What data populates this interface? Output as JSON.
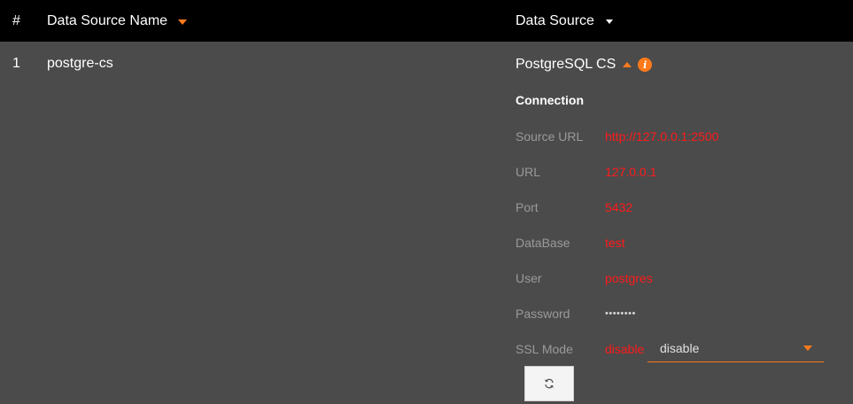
{
  "header": {
    "index_label": "#",
    "name_column_label": "Data Source Name",
    "source_column_label": "Data Source"
  },
  "row": {
    "index": "1",
    "name": "postgre-cs",
    "data_source_title": "PostgreSQL CS",
    "info_icon_glyph": "i"
  },
  "connection": {
    "heading": "Connection",
    "source_url": {
      "label": "Source URL",
      "value": "http://127.0.0.1:2500"
    },
    "url": {
      "label": "URL",
      "value": "127.0.0.1"
    },
    "port": {
      "label": "Port",
      "value": "5432"
    },
    "database": {
      "label": "DataBase",
      "value": "test"
    },
    "user": {
      "label": "User",
      "value": "postgres"
    },
    "password": {
      "label": "Password",
      "value": "••••••••"
    },
    "ssl_mode": {
      "label": "SSL Mode",
      "value": "disable",
      "selected_option": "disable"
    }
  },
  "icons": {
    "sort_caret": "chevron-down-icon",
    "collapse_caret": "chevron-up-icon",
    "info": "info-icon",
    "refresh": "refresh-icon"
  },
  "colors": {
    "header_bg": "#000000",
    "body_bg": "#4b4b4b",
    "accent": "#ff7a1a",
    "error_value": "#ff1a1a",
    "label": "#9a9a9a"
  }
}
